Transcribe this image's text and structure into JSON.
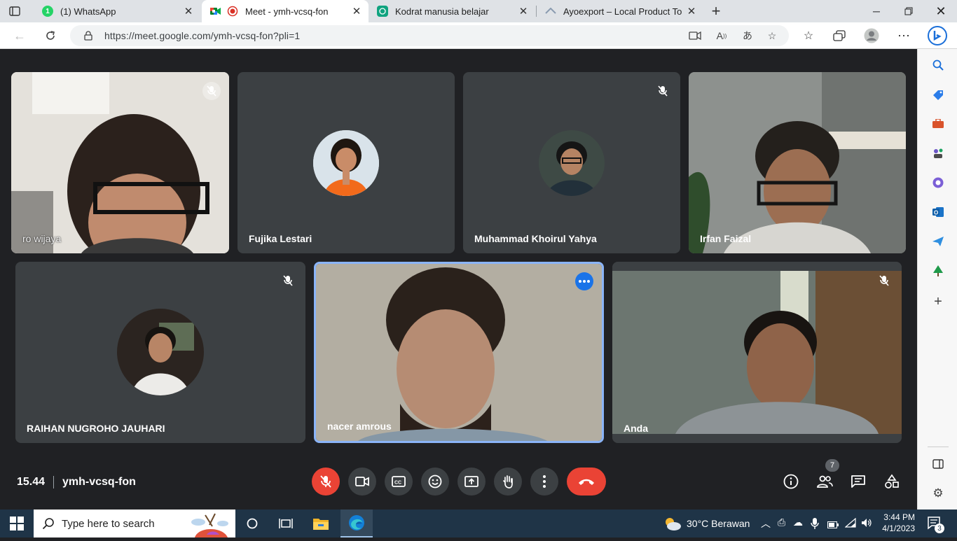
{
  "browser": {
    "tabs": [
      {
        "title": "(1) WhatsApp",
        "badge": "1",
        "active": false
      },
      {
        "title": "Meet - ymh-vcsq-fon",
        "active": true
      },
      {
        "title": "Kodrat manusia belajar",
        "active": false
      },
      {
        "title": "Ayoexport – Local Product To Int",
        "active": false
      }
    ],
    "url": "https://meet.google.com/ymh-vcsq-fon?pli=1"
  },
  "meet": {
    "participants": [
      {
        "name": "ro wijaya",
        "muted": true,
        "video": true
      },
      {
        "name": "Fujika Lestari",
        "muted": false,
        "video": false
      },
      {
        "name": "Muhammad Khoirul Yahya",
        "muted": true,
        "video": false
      },
      {
        "name": "Irfan Faizal",
        "muted": false,
        "video": true
      },
      {
        "name": "RAIHAN NUGROHO JAUHARI",
        "muted": true,
        "video": false
      },
      {
        "name": "nacer amrous",
        "muted": false,
        "video": true,
        "speaking": true
      },
      {
        "name": "Anda",
        "muted": true,
        "video": true
      }
    ],
    "time": "15.44",
    "meeting_code": "ymh-vcsq-fon",
    "people_count": "7",
    "colors": {
      "background": "#202124",
      "tile": "#3c4043",
      "accent": "#1a73e8",
      "danger": "#ea4335"
    }
  },
  "taskbar": {
    "search_placeholder": "Type here to search",
    "weather": "30°C  Berawan",
    "time": "3:44 PM",
    "date": "4/1/2023",
    "notifications": "3"
  }
}
